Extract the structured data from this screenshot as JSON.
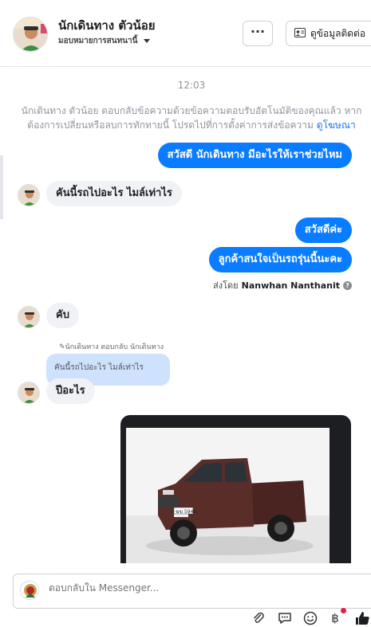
{
  "header": {
    "name": "นักเดินทาง ตัวน้อย",
    "subtitle": "มอบหมายการสนทนานี้",
    "more_label": "···",
    "contact_label": "ดูข้อมูลติดต่อ",
    "icons": [
      "contact-card-icon",
      "chevron-down-icon"
    ]
  },
  "chat": {
    "timestamp": "12:03",
    "system_note": "นักเดินทาง ตัวน้อย ตอบกลับข้อความด้วยข้อความตอบรับอัตโนมัติของคุณแล้ว หากต้องการเปลี่ยนหรือลบการทักทายนี้ โปรดไปที่การตั้งค่าการส่งข้อความ",
    "system_link": "ดูโฆษณา",
    "messages": [
      {
        "side": "out",
        "text": "สวัสดี นักเดินทาง มีอะไรให้เราช่วยไหม"
      },
      {
        "side": "in",
        "text": "คันนี้รถไปอะไร  ไมล์เท่าไร"
      },
      {
        "side": "out",
        "text": "สวัสดีค่ะ"
      },
      {
        "side": "out",
        "text": "ลูกค้าสนใจเป็นรถรุ่นนี้นะคะ"
      },
      {
        "side": "in",
        "text": "คับ"
      },
      {
        "side": "in",
        "text": "ปีอะไร"
      }
    ],
    "sent_by_prefix": "ส่งโดย",
    "sent_by_name": "Nanwhan Nanthanit",
    "help_glyph": "?",
    "reply_label": "นักเดินทาง ตอบกลับ นักเดินทาง",
    "reply_quote": "คันนี้รถไปอะไร ไมล์เท่าไร",
    "photo": {
      "plate_text": "ฆฆ 5948",
      "colors": {
        "truck_body": "#5a2e28",
        "background": "#f2f2f2",
        "card": "#1c1e21"
      }
    }
  },
  "composer": {
    "placeholder": "ตอบกลับใน Messenger...",
    "baht_label": "฿",
    "tools": [
      "paperclip-icon",
      "chat-bubble-icon",
      "smiley-icon",
      "baht-icon",
      "thumbs-up-icon"
    ]
  },
  "colors": {
    "accent": "#0a7cff",
    "incoming_bubble": "#f0f2f5",
    "reply_quote": "#cfe2fd",
    "muted_text": "#90949c",
    "notification_dot": "#e41e3f"
  }
}
